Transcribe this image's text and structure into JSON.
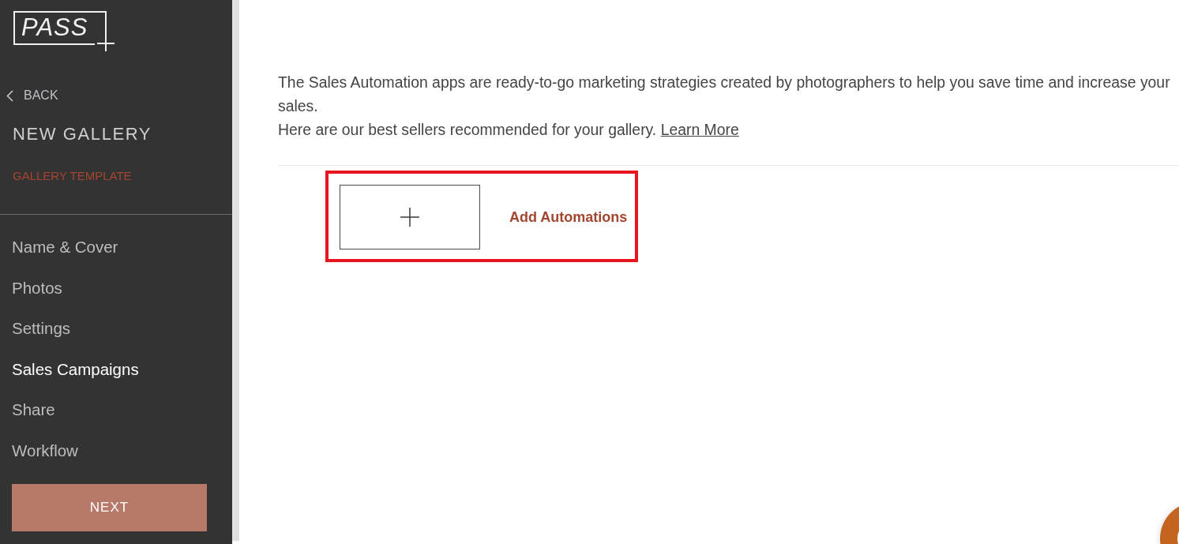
{
  "sidebar": {
    "logo": {
      "text": "PASS"
    },
    "back": {
      "label": "BACK"
    },
    "title": "NEW GALLERY",
    "subtitle": "GALLERY TEMPLATE",
    "nav": [
      {
        "label": "Name & Cover",
        "selected": false
      },
      {
        "label": "Photos",
        "selected": false
      },
      {
        "label": "Settings",
        "selected": false
      },
      {
        "label": "Sales Campaigns",
        "selected": true
      },
      {
        "label": "Share",
        "selected": false
      },
      {
        "label": "Workflow",
        "selected": false
      }
    ],
    "next_button": {
      "label": "NEXT"
    }
  },
  "main": {
    "description": "The Sales Automation apps are ready-to-go marketing strategies created by photographers to help you save time and increase your sales.",
    "recommendation": "Here are our best sellers recommended for your gallery.",
    "learn_more": "Learn More",
    "add_automations": {
      "label": "Add Automations",
      "highlighted": true
    }
  }
}
